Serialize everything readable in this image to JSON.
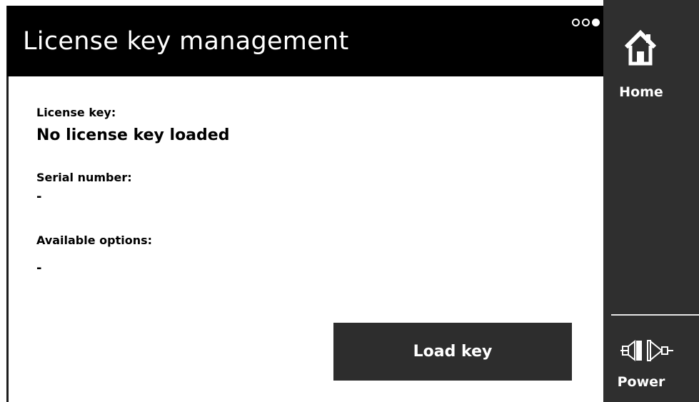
{
  "header": {
    "title": "License key management"
  },
  "page_indicator": {
    "total": 3,
    "current": 3
  },
  "license": {
    "key_label": "License key:",
    "key_value": "No license key loaded",
    "serial_label": "Serial number:",
    "serial_value": "-",
    "options_label": "Available options:",
    "options_value": "-"
  },
  "actions": {
    "load_key_label": "Load key"
  },
  "sidebar": {
    "home_label": "Home",
    "home_icon": "home-icon",
    "power_label": "Power",
    "power_icon": "power-plug-icon"
  },
  "colors": {
    "header_bg": "#000000",
    "sidebar_bg": "#2f2f2f",
    "button_bg": "#2d2d2d",
    "text_light": "#ffffff"
  }
}
